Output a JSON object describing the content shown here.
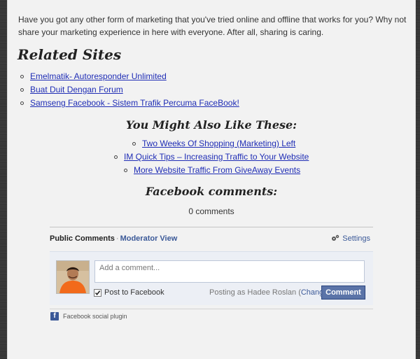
{
  "intro_text": "Have you got any other form of marketing that you've tried online and offline that works for you? Why not share your marketing experience in here with everyone. After all, sharing is caring.",
  "related": {
    "heading": "Related Sites",
    "items": [
      "Emelmatik- Autoresponder Unlimited",
      "Buat Duit Dengan Forum",
      "Samseng Facebook - Sistem Trafik Percuma FaceBook!"
    ]
  },
  "also_like": {
    "heading": "You Might Also Like These:",
    "items": [
      "Two Weeks Of Shopping (Marketing) Left",
      "IM Quick Tips – Increasing Traffic to Your Website",
      "More Website Traffic From GiveAway Events"
    ]
  },
  "fb_comments": {
    "heading": "Facebook comments:",
    "count": "0 comments",
    "tab_public": "Public Comments",
    "separator": "·",
    "tab_moderator": "Moderator View",
    "settings": "Settings",
    "placeholder": "Add a comment...",
    "post_to_facebook": "Post to Facebook",
    "post_checked": true,
    "posting_as_prefix": "Posting as Hadee Roslan (",
    "change": "Change",
    "posting_as_suffix": ")",
    "comment_button": "Comment",
    "plugin_label": "Facebook social plugin",
    "icons": {
      "settings": "gear-icon",
      "checkbox": "checkmark-icon",
      "plugin": "facebook-logo-icon"
    },
    "colors": {
      "fb_blue": "#3b5998",
      "button": "#5b74a8",
      "link": "#1f2db5"
    }
  }
}
